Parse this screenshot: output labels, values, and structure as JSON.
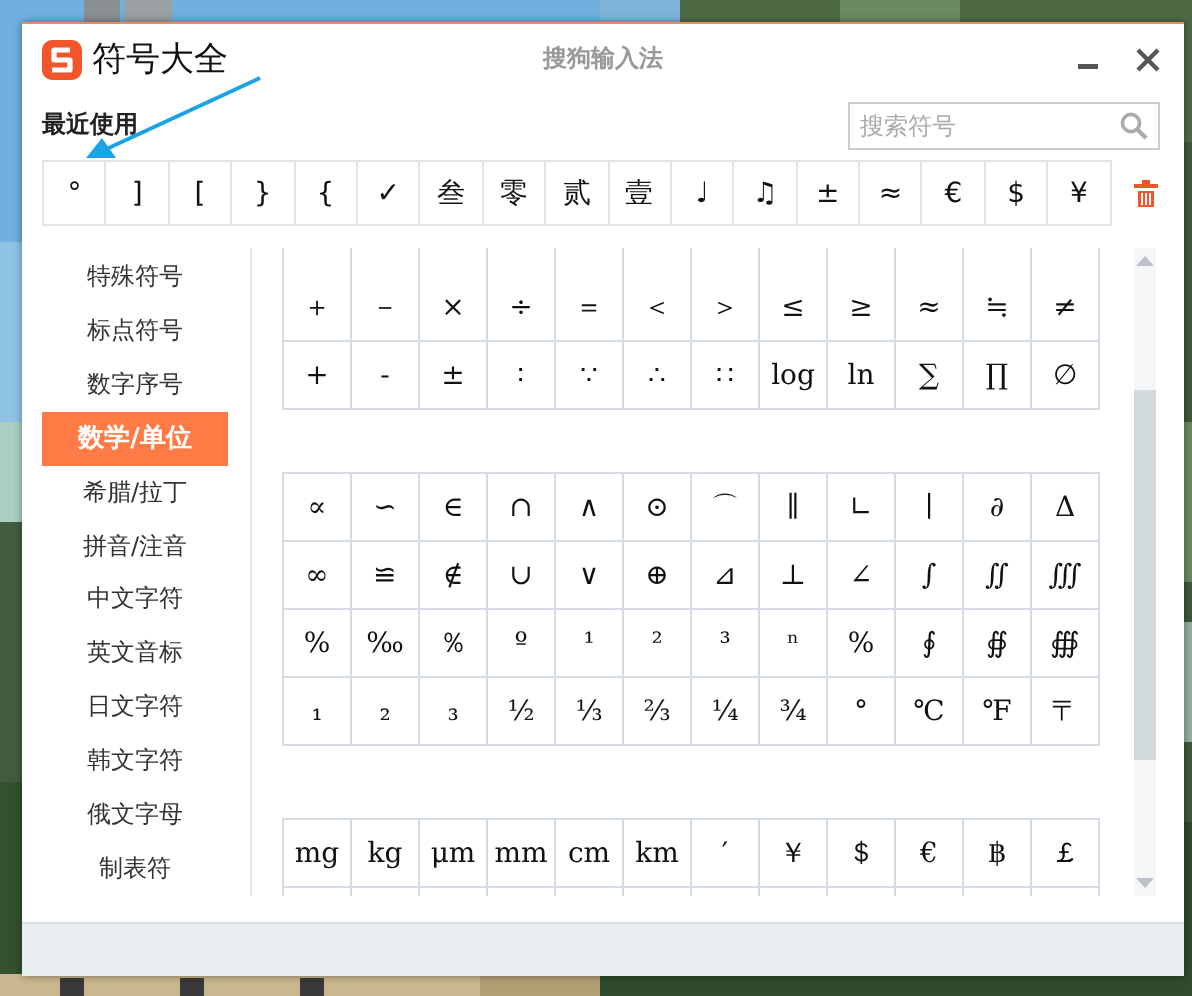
{
  "window": {
    "app_name": "符号大全",
    "title": "搜狗输入法"
  },
  "recent": {
    "label": "最近使用",
    "symbols": [
      "°",
      "]",
      "[",
      "}",
      "{",
      "✓",
      "叁",
      "零",
      "贰",
      "壹",
      "♩",
      "♫",
      "±",
      "≈",
      "€",
      "$",
      "¥"
    ]
  },
  "search": {
    "placeholder": "搜索符号"
  },
  "categories": [
    {
      "label": "特殊符号",
      "selected": false
    },
    {
      "label": "标点符号",
      "selected": false
    },
    {
      "label": "数字序号",
      "selected": false
    },
    {
      "label": "数学/单位",
      "selected": true
    },
    {
      "label": "希腊/拉丁",
      "selected": false
    },
    {
      "label": "拼音/注音",
      "selected": false
    },
    {
      "label": "中文字符",
      "selected": false
    },
    {
      "label": "英文音标",
      "selected": false
    },
    {
      "label": "日文字符",
      "selected": false
    },
    {
      "label": "韩文字符",
      "selected": false
    },
    {
      "label": "俄文字母",
      "selected": false
    },
    {
      "label": "制表符",
      "selected": false
    }
  ],
  "symbol_groups": [
    {
      "rows": [
        [
          "＋",
          "－",
          "×",
          "÷",
          "＝",
          "＜",
          "＞",
          "≤",
          "≥",
          "≈",
          "≒",
          "≠"
        ],
        [
          "+",
          "-",
          "±",
          "∶",
          "∵",
          "∴",
          "∷",
          "log",
          "ln",
          "∑",
          "∏",
          "∅"
        ]
      ]
    },
    {
      "rows": [
        [
          "∝",
          "∽",
          "∈",
          "∩",
          "∧",
          "⊙",
          "⌒",
          "∥",
          "∟",
          "∣",
          "∂",
          "Δ"
        ],
        [
          "∞",
          "≌",
          "∉",
          "∪",
          "∨",
          "⊕",
          "⊿",
          "⊥",
          "∠",
          "∫",
          "∬",
          "∭"
        ],
        [
          "%",
          "‰",
          "％",
          "º",
          "¹",
          "²",
          "³",
          "ⁿ",
          "%",
          "∮",
          "∯",
          "∰"
        ],
        [
          "₁",
          "₂",
          "₃",
          "½",
          "⅓",
          "⅔",
          "¼",
          "¾",
          "°",
          "℃",
          "℉",
          "〒"
        ]
      ]
    },
    {
      "rows": [
        [
          "mg",
          "kg",
          "μm",
          "mm",
          "cm",
          "km",
          "′",
          "￥",
          "＄",
          "€",
          "฿",
          "￡"
        ]
      ]
    }
  ]
}
